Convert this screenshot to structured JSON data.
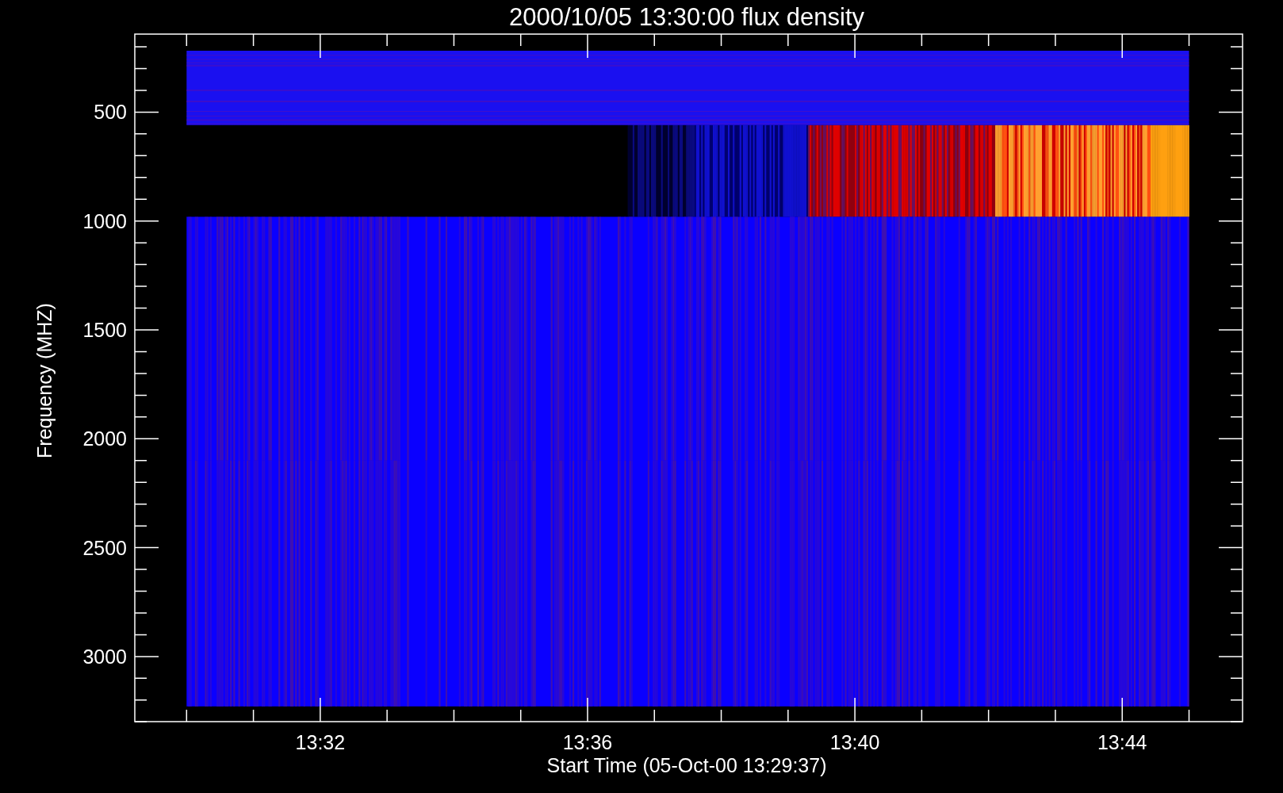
{
  "title": "2000/10/05 13:30:00 flux density",
  "xlabel": "Start Time (05-Oct-00 13:29:37)",
  "ylabel": "Frequency (MHZ)",
  "yticks": [
    "500",
    "1000",
    "1500",
    "2000",
    "2500",
    "3000"
  ],
  "xticks": [
    "13:32",
    "13:36",
    "13:40",
    "13:44"
  ]
}
